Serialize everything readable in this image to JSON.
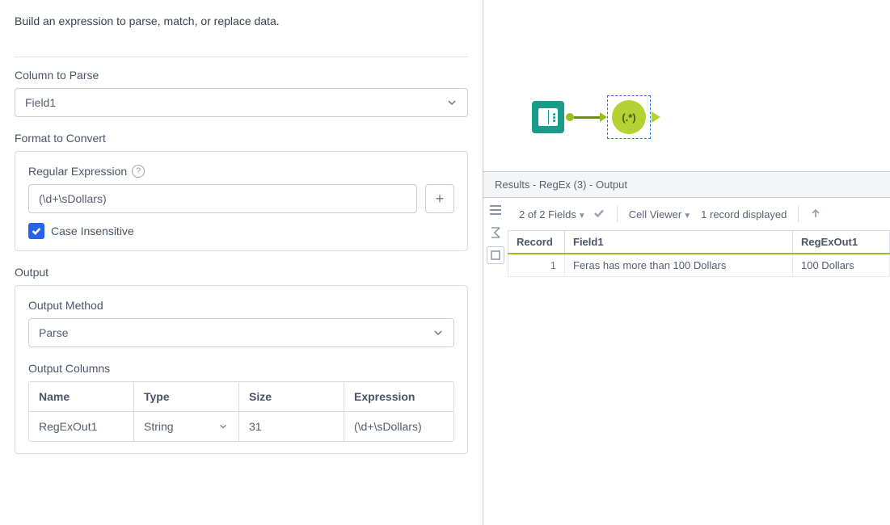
{
  "intro_text": "Build an expression to parse, match, or replace data.",
  "column_to_parse_label": "Column to Parse",
  "column_to_parse_value": "Field1",
  "format_to_convert_label": "Format to Convert",
  "regular_expression_label": "Regular Expression",
  "regex_value": "(\\d+\\sDollars)",
  "case_insensitive_label": "Case Insensitive",
  "case_insensitive_checked": true,
  "output_label": "Output",
  "output_method_label": "Output Method",
  "output_method_value": "Parse",
  "output_columns_label": "Output Columns",
  "columns_headers": {
    "name": "Name",
    "type": "Type",
    "size": "Size",
    "expression": "Expression"
  },
  "columns_rows": [
    {
      "name": "RegExOut1",
      "type": "String",
      "size": "31",
      "expression": "(\\d+\\sDollars)"
    }
  ],
  "regex_tool_text": "(.*)",
  "results_title": "Results - RegEx (3) - Output",
  "fields_count": "2 of 2 Fields",
  "cell_viewer_label": "Cell Viewer",
  "records_displayed": "1 record displayed",
  "table_headers": {
    "record": "Record",
    "field1": "Field1",
    "regexout1": "RegExOut1"
  },
  "table_rows": [
    {
      "record": "1",
      "field1": "Feras has more than 100 Dollars",
      "regexout1": "100 Dollars"
    }
  ]
}
